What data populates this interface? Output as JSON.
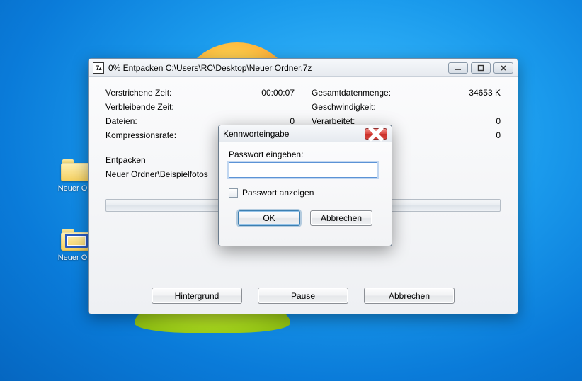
{
  "desktop": {
    "icons": [
      {
        "label": "Neuer O…"
      },
      {
        "label": "Neuer O…"
      }
    ]
  },
  "mainWindow": {
    "app_icon_text": "7z",
    "title": "0% Entpacken C:\\Users\\RC\\Desktop\\Neuer Ordner.7z",
    "stats": {
      "left": [
        {
          "label": "Verstrichene Zeit:",
          "value": "00:00:07"
        },
        {
          "label": "Verbleibende Zeit:",
          "value": ""
        },
        {
          "label": "Dateien:",
          "value": "0"
        },
        {
          "label": "Kompressionsrate:",
          "value": ""
        }
      ],
      "right": [
        {
          "label": "Gesamtdatenmenge:",
          "value": "34653 K"
        },
        {
          "label": "Geschwindigkeit:",
          "value": ""
        },
        {
          "label": "Verarbeitet:",
          "value": "0"
        },
        {
          "label": "",
          "value": "0"
        }
      ]
    },
    "section_label": "Entpacken",
    "current_path": "Neuer Ordner\\Beispielfotos",
    "buttons": {
      "background": "Hintergrund",
      "pause": "Pause",
      "cancel": "Abbrechen"
    }
  },
  "passwordDialog": {
    "title": "Kennworteingabe",
    "prompt": "Passwort eingeben:",
    "input_value": "",
    "show_checkbox_label": "Passwort anzeigen",
    "ok": "OK",
    "cancel": "Abbrechen"
  }
}
